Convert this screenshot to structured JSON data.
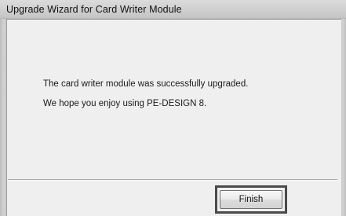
{
  "window": {
    "title": "Upgrade Wizard for Card Writer Module"
  },
  "content": {
    "message_success": "The card writer module was successfully upgraded.",
    "message_enjoy": "We hope you enjoy using PE-DESIGN 8."
  },
  "buttons": {
    "finish_label": "Finish"
  }
}
